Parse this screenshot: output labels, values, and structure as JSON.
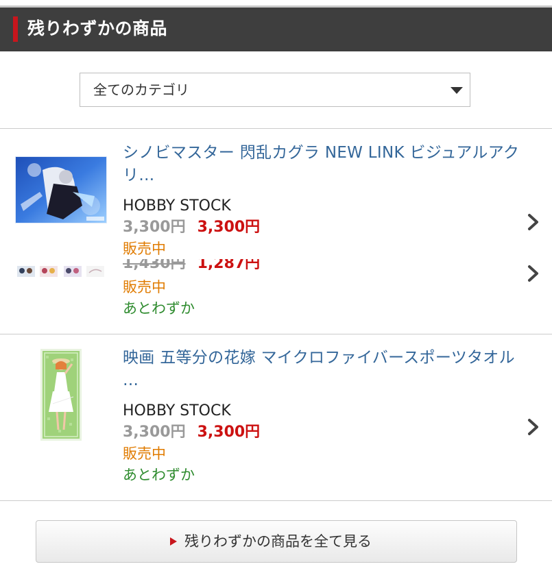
{
  "section": {
    "title": "残りわずかの商品"
  },
  "category_select": {
    "selected": "全てのカテゴリ"
  },
  "products": [
    {
      "title": "シノビマスター 閃乱カグラ NEW LINK ビジュアルアクリ…",
      "shop": "HOBBY STOCK",
      "price_old": "3,300円",
      "price_new": "3,300円",
      "status": "販売中"
    },
    {
      "price_old": "1,430円",
      "price_new": "1,287円",
      "status": "販売中",
      "stock": "あとわずか"
    },
    {
      "title": "映画 五等分の花嫁 マイクロファイバースポーツタオル …",
      "shop": "HOBBY STOCK",
      "price_old": "3,300円",
      "price_new": "3,300円",
      "status": "販売中",
      "stock": "あとわずか"
    }
  ],
  "see_all": {
    "label": "残りわずかの商品を全て見る"
  },
  "colors": {
    "header_bg": "#3e3e3e",
    "accent_red": "#c8161d",
    "title_blue": "#336699",
    "price_red": "#cc1111",
    "status_orange": "#e07b00",
    "stock_green": "#2e8b2e"
  }
}
